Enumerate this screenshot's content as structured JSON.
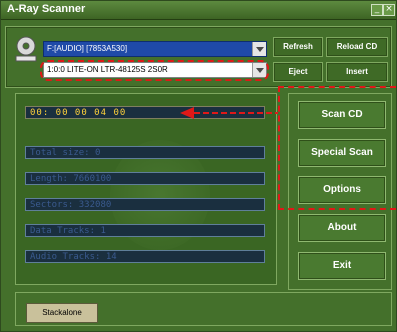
{
  "window": {
    "title": "A-Ray Scanner",
    "controls": [
      "minimize",
      "close"
    ]
  },
  "drives": {
    "selected_primary": "F:[AUDIO] [7853A530]",
    "selected_secondary": "1:0:0 LITE-ON LTR-48125S 2S0R"
  },
  "buttons": {
    "refresh": "Refresh",
    "reload_cd": "Reload CD",
    "eject": "Eject",
    "insert": "Insert",
    "scan_cd": "Scan CD",
    "special_scan": "Special Scan",
    "options": "Options",
    "about": "About",
    "exit": "Exit",
    "status": "Stackalone"
  },
  "fields": {
    "time": "00: 00 00 04 00",
    "total_size": "Total size: 0",
    "length": "Length: 7660100",
    "sectors": "Sectors: 332080",
    "data_tracks": "Data Tracks: 1",
    "audio_tracks": "Audio Tracks: 14"
  },
  "colors": {
    "window_bg": "#44702b",
    "highlight": "#e01818",
    "time_text": "#ffd23a",
    "field_text": "#3a5a8e",
    "selected_bg": "#1f4aa8"
  },
  "icons": {
    "drive": "cd-drive-icon",
    "dropdown": "chevron-down-icon",
    "arrow": "red-arrow-icon"
  }
}
